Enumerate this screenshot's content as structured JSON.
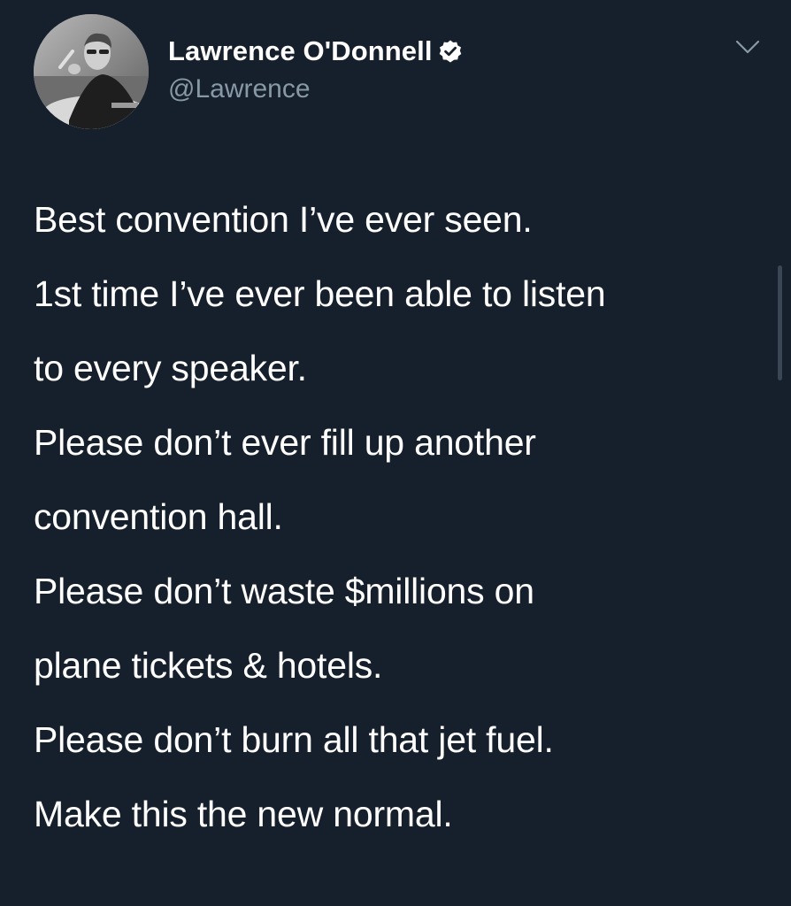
{
  "user": {
    "display_name": "Lawrence O'Donnell",
    "handle": "@Lawrence",
    "verified": true
  },
  "tweet": {
    "lines": [
      "Best convention I’ve ever seen.",
      "1st time I’ve ever been able to listen",
      "to every speaker.",
      "Please don’t ever fill up another",
      "convention hall.",
      "Please don’t waste $millions on",
      "plane tickets & hotels.",
      "Please don’t burn all that jet fuel.",
      "Make this the new normal."
    ]
  },
  "icons": {
    "verified": "verified-badge-icon",
    "more": "chevron-down-icon"
  },
  "colors": {
    "background": "#16202c",
    "text": "#ffffff",
    "secondary_text": "#8899a6"
  }
}
